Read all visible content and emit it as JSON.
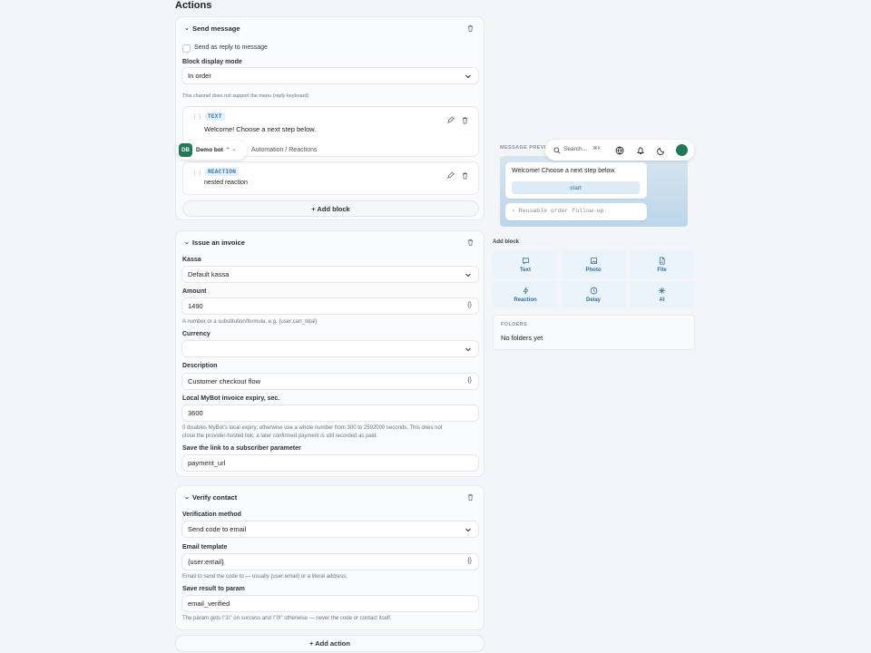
{
  "page": {
    "title": "Actions"
  },
  "send_message": {
    "title": "Send message",
    "reply_label": "Send as reply to message",
    "display_mode_label": "Block display mode",
    "display_mode_value": "In order",
    "menu_notice": "This channel does not support the menu (reply keyboard)",
    "blocks": [
      {
        "tag": "TEXT",
        "text": "Welcome! Choose a next step below."
      },
      {
        "tag": "REACTION",
        "text": "nested reaction"
      }
    ],
    "add_block_label": "+ Add block"
  },
  "floating_tab": {
    "avatar": "DB",
    "bot_name": "Demo bot",
    "breadcrumb": "Automation / Reactions"
  },
  "invoice": {
    "title": "Issue an invoice",
    "kassa_label": "Kassa",
    "kassa_value": "Default kassa",
    "amount_label": "Amount",
    "amount_value": "1490",
    "amount_hint": "A number or a substitution/formula, e.g. {user:cart_total}",
    "currency_label": "Currency",
    "currency_value": "",
    "description_label": "Description",
    "description_value": "Customer checkout flow",
    "expiry_label": "Local MyBot invoice expiry, sec.",
    "expiry_value": "3600",
    "expiry_hint_1": "0 disables MyBot's local expiry; otherwise use a whole number from 300 to 2592000 seconds. This does not",
    "expiry_hint_2": "close the provider-hosted link; a later confirmed payment is still recorded as paid.",
    "link_param_label": "Save the link to a subscriber parameter",
    "link_param_value": "payment_url"
  },
  "verify": {
    "title": "Verify contact",
    "method_label": "Verification method",
    "method_value": "Send code to email",
    "template_label": "Email template",
    "template_value": "{user:email}",
    "template_hint": "Email to send the code to — usually {user:email} or a literal address.",
    "result_label": "Save result to param",
    "result_value": "email_verified",
    "result_hint": "The param gets \\\"1\\\" on success and \\\"0\\\" otherwise — never the code or contact itself."
  },
  "add_action_label": "+ Add action",
  "braces": "{}",
  "preview": {
    "label": "MESSAGE PREVIEW",
    "message": "Welcome! Choose a next step below.",
    "button": "start",
    "reusable": "› Reusable order follow-up"
  },
  "topbar": {
    "search_placeholder": "Search...",
    "shortcut": "⌘K"
  },
  "add_block_panel": {
    "label": "Add block",
    "tiles": [
      {
        "label": "Text",
        "icon": "message-icon"
      },
      {
        "label": "Photo",
        "icon": "image-icon"
      },
      {
        "label": "File",
        "icon": "file-icon"
      },
      {
        "label": "Reaction",
        "icon": "lightning-icon"
      },
      {
        "label": "Delay",
        "icon": "clock-icon"
      },
      {
        "label": "AI",
        "icon": "sparkle-icon"
      }
    ]
  },
  "folders": {
    "label": "FOLDERS",
    "empty": "No folders yet"
  },
  "colors": {
    "accent": "#1f7a57",
    "tag_blue": "#2a7ab8"
  }
}
